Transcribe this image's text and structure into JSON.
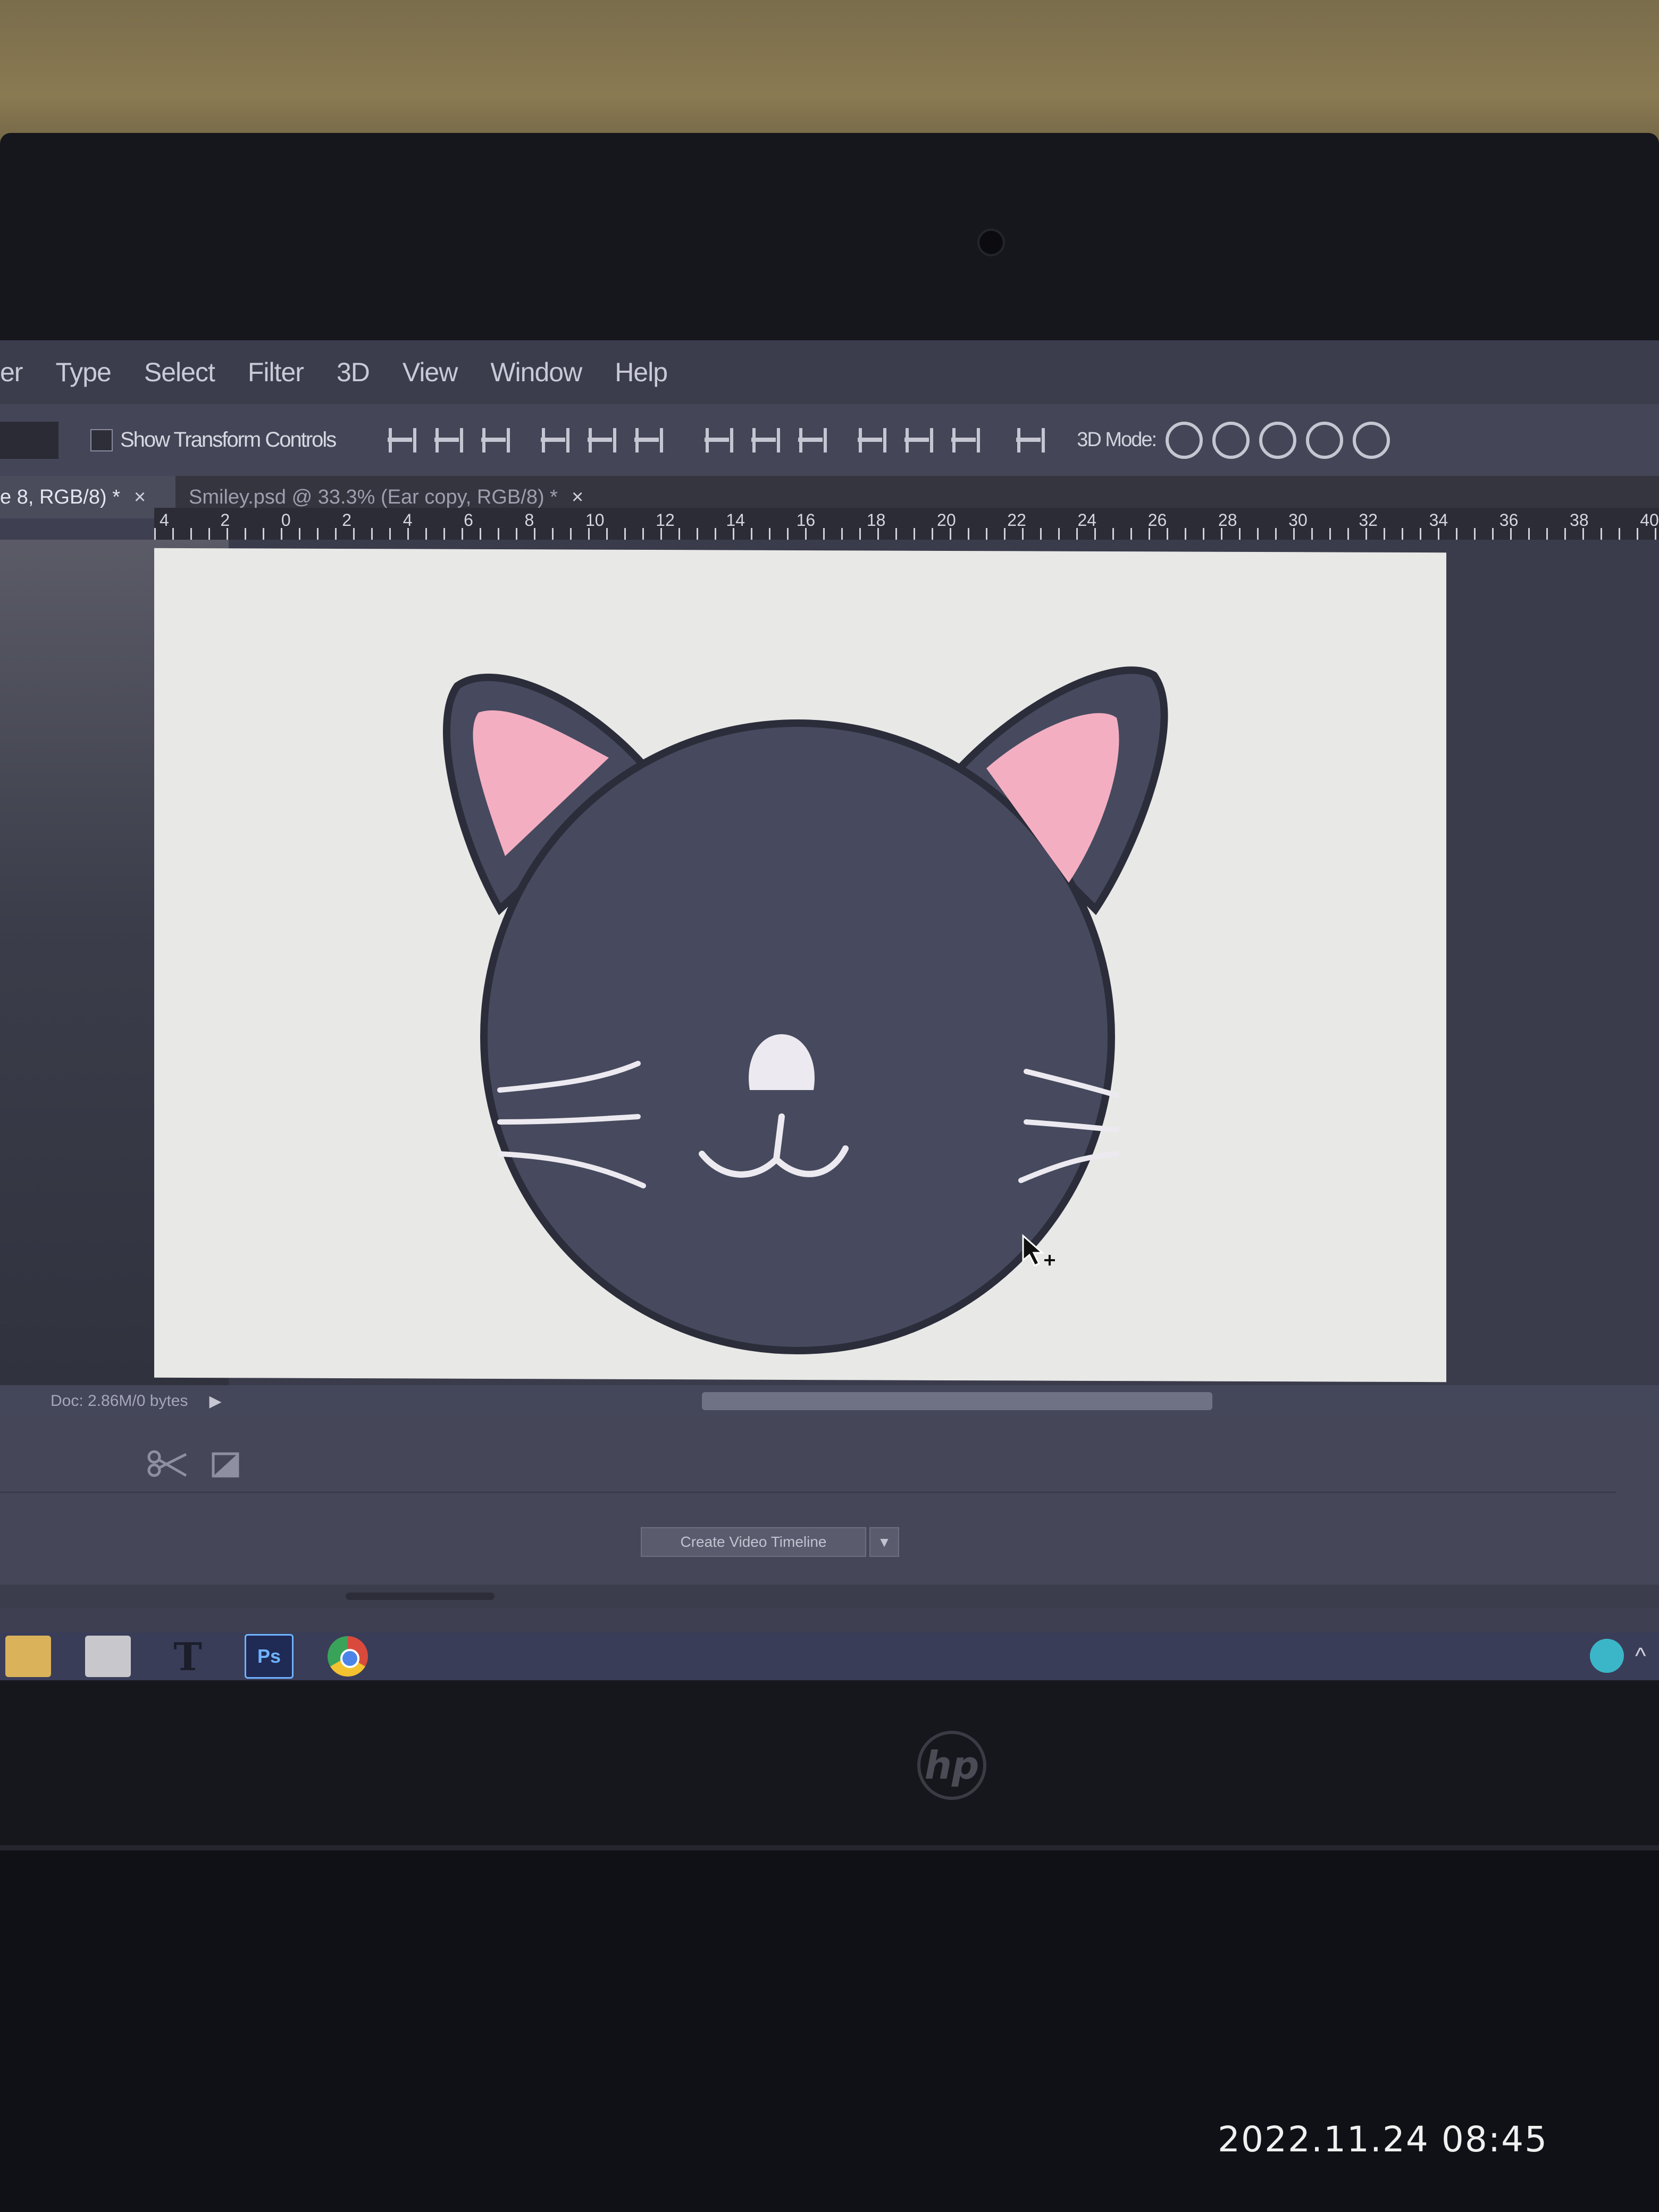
{
  "menu": {
    "items": [
      "er",
      "Type",
      "Select",
      "Filter",
      "3D",
      "View",
      "Window",
      "Help"
    ]
  },
  "options_bar": {
    "show_transform_label": "Show Transform Controls",
    "mode_3d_label": "3D Mode:"
  },
  "tabs": [
    {
      "label": "e 8, RGB/8) *",
      "close": "×"
    },
    {
      "label": "Smiley.psd @ 33.3% (Ear copy, RGB/8) *",
      "close": "×"
    }
  ],
  "ruler_ticks": [
    "4",
    "2",
    "0",
    "2",
    "4",
    "6",
    "8",
    "10",
    "12",
    "14",
    "16",
    "18",
    "20",
    "22",
    "24",
    "26",
    "28",
    "30",
    "32",
    "34",
    "36",
    "38",
    "40"
  ],
  "status": {
    "doc_size": "Doc: 2.86M/0 bytes",
    "arrow": "▶"
  },
  "timeline": {
    "create_button": "Create Video Timeline",
    "dropdown": "▼"
  },
  "taskbar": {
    "ps_label": "Ps",
    "tfont_label": "T"
  },
  "bezel": {
    "brand": "hp"
  },
  "photo_timestamp": "2022.11.24 08:45",
  "colors": {
    "cat_fur": "#474a5e",
    "ear_inner": "#f4aec2",
    "canvas": "#e8e8e6"
  }
}
